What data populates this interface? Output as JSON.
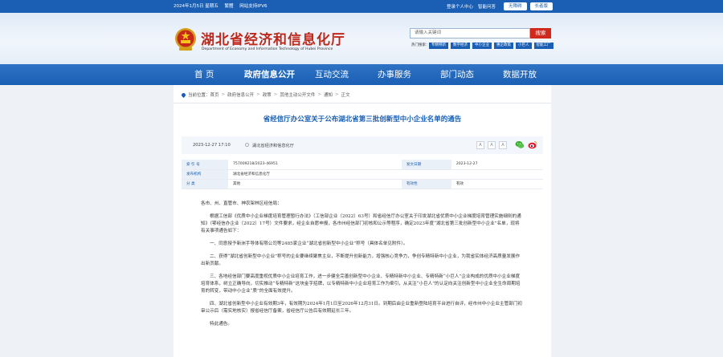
{
  "topbar": {
    "date": "2024年1月5日 星期五",
    "weather": "繁體",
    "ipv6": "网站支持IPV6",
    "login": "登录个人中心",
    "weibo": "智能问答",
    "btn_barrier": "无障碍",
    "btn_elderly": "长者版"
  },
  "header": {
    "title": "湖北省经济和信息化厅",
    "title_en": "Department of Economy and Information Technology of Hubei Province",
    "search_placeholder": "请输入关键词",
    "search_button": "搜索",
    "hot_label": "热门搜索：",
    "hot_tags": [
      "专精特新",
      "数字经济",
      "中小企业",
      "惠企政策",
      "小巨人",
      "智能工厂"
    ]
  },
  "nav": {
    "items": [
      "首 页",
      "政府信息公开",
      "互动交流",
      "办事服务",
      "部门动态",
      "数据开放"
    ]
  },
  "breadcrumb": {
    "label": "当前位置：",
    "items": [
      "首页",
      "政府信息公开",
      "政策",
      "其他主动公开文件",
      "通知",
      "正文"
    ]
  },
  "article": {
    "title": "省经信厅办公室关于公布湖北省第三批创新型中小企业名单的通告",
    "date": "2023-12-27 17:10",
    "source": "湖北省经济和信息化厅",
    "font_labels": [
      "A",
      "A",
      "A"
    ],
    "info": {
      "k_index": "索 引 号",
      "v_index": "757009218/2023-46951",
      "k_date": "发文日期",
      "v_date": "2023-12-27",
      "k_org": "发布机构",
      "v_org": "湖北省经济和信息化厅",
      "k_cat": "分 类",
      "v_cat": "其他",
      "k_valid": "有效性",
      "v_valid": "有效"
    },
    "paragraphs": [
      "各市、州、直管市、神农架林区经信局：",
      "根据工信部《优质中小企业梯度培育管理暂行办法》（工信部企业〔2022〕63号）和省经信厅办公室关于印发湖北省优质中小企业梯度培育管理实施细则的通知》（鄂经信办企业〔2022〕17号）文件要求，经企业自愿申报，各市州经信部门初核和公示等程序，确定2023年度“湖北省第三批创新型中小企业”名单，现将有关事项通告如下：",
      "一、同意授予新洲手导体有限公司等2485家企业“湖北省创新型中小企业”称号（具体名单见附件）。",
      "二、获得“湖北省创新型中小企业”称号的企业要继续聚焦主业，不断提升创新能力，增强核心竞争力，争创专精特新中小企业，为我省实体经济高质量发展作出新贡献。",
      "三、各地经信部门要高度重视优质中小企业培育工作，进一步健全完善创新型中小企业、专精特新中小企业、专精特新“小巨人”企业构成的优质中小企业梯度培育体系，树立正确导向，切实推动“专精特新”这块金字招牌，以专精特新中小企业培育工作为牵引，从关注“小巨人”的认定向关注创新型中小企业全生命周期培育的转变，带动中小企业“质”的全面有效提升。",
      "四、湖北省创新型中小企业有效期3年，有效期为2024年1月1日至2026年12月31日。到期后由企业重新登陆培育平台进行自评，经市州中小企业主管部门初审公示后（需实地核实）报省经信厅备案，省经信厅公告后有效期延长三年。",
      "特此通告。"
    ]
  },
  "colors": {
    "primary": "#1a5fb4",
    "title_red": "#c0281b",
    "search_red": "#d0281c"
  }
}
